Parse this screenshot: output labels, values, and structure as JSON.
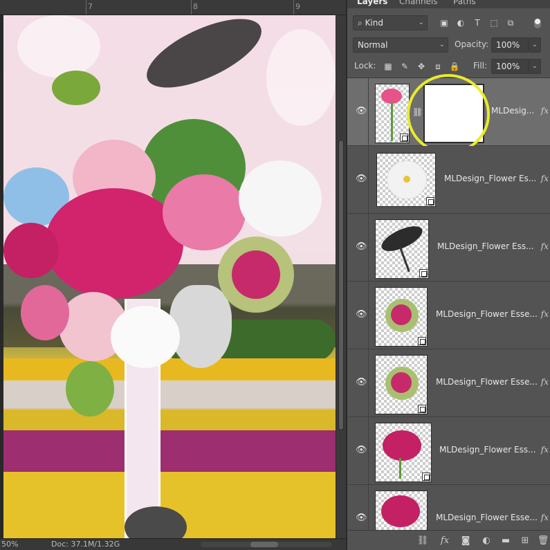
{
  "ruler": {
    "ticks": [
      "7",
      "8",
      "9"
    ]
  },
  "status": {
    "zoom": "50%",
    "doc": "Doc: 37.1M/1.32G"
  },
  "panel": {
    "tabs": [
      "Layers",
      "Channels",
      "Paths"
    ],
    "filter": {
      "kind_label": "Kind"
    },
    "blend_mode": "Normal",
    "opacity_label": "Opacity:",
    "opacity_value": "100%",
    "lock_label": "Lock:",
    "fill_label": "Fill:",
    "fill_value": "100%"
  },
  "layers": [
    {
      "name": "MLDesig...",
      "fx": "fx",
      "selected": true
    },
    {
      "name": "MLDesign_Flower Es...",
      "fx": "fx"
    },
    {
      "name": "MLDesign_Flower Ess...",
      "fx": "fx"
    },
    {
      "name": "MLDesign_Flower Esse...",
      "fx": "fx"
    },
    {
      "name": "MLDesign_Flower Esse...",
      "fx": "fx"
    },
    {
      "name": "MLDesign_Flower Ess...",
      "fx": "fx"
    },
    {
      "name": "MLDesign_Flower Esse...",
      "fx": "fx"
    }
  ],
  "bottom_bar": {
    "fx_label": "fx"
  },
  "colors": {
    "highlight": "#e9ec28",
    "panel_bg": "#535353",
    "selected_row": "#6e6e6e"
  }
}
